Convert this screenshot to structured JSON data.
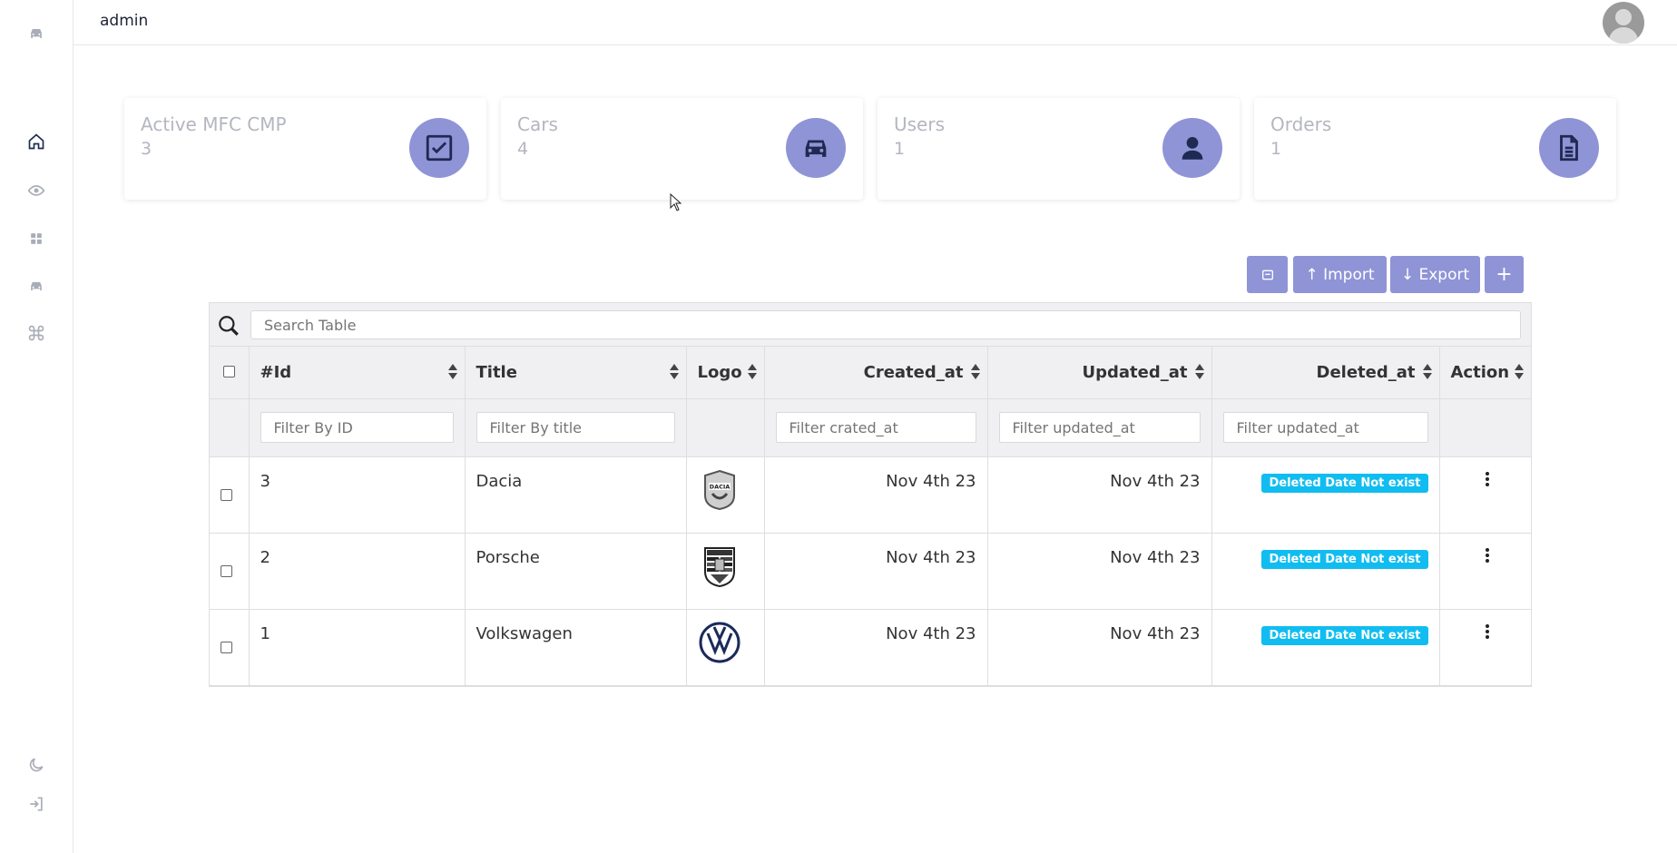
{
  "app": {
    "title": "admin"
  },
  "sidebar": {
    "items": [
      {
        "icon": "car-icon"
      },
      {
        "icon": "home-icon"
      },
      {
        "icon": "eye-icon"
      },
      {
        "icon": "grid-icon"
      },
      {
        "icon": "car-icon"
      },
      {
        "icon": "command-icon"
      },
      {
        "icon": "moon-icon"
      },
      {
        "icon": "logout-icon"
      }
    ]
  },
  "cards": [
    {
      "label": "Active MFC CMP",
      "value": "3",
      "icon": "checkbox-icon"
    },
    {
      "label": "Cars",
      "value": "4",
      "icon": "car-icon"
    },
    {
      "label": "Users",
      "value": "1",
      "icon": "user-icon"
    },
    {
      "label": "Orders",
      "value": "1",
      "icon": "document-icon"
    }
  ],
  "toolbar": {
    "import_label": "↑ Import",
    "export_label": "↓ Export",
    "add_label": "+"
  },
  "search": {
    "placeholder": "Search Table"
  },
  "table": {
    "columns": [
      "#Id",
      "Title",
      "Logo",
      "Created_at",
      "Updated_at",
      "Deleted_at",
      "Action"
    ],
    "filters": {
      "id": "Filter By ID",
      "title": "Filter By title",
      "created": "Filter crated_at",
      "updated": "Filter updated_at",
      "deleted": "Filter updated_at"
    },
    "rows": [
      {
        "id": "3",
        "title": "Dacia",
        "logo": "dacia-logo",
        "created": "Nov 4th 23",
        "updated": "Nov 4th 23",
        "deleted": "Deleted Date Not exist"
      },
      {
        "id": "2",
        "title": "Porsche",
        "logo": "porsche-logo",
        "created": "Nov 4th 23",
        "updated": "Nov 4th 23",
        "deleted": "Deleted Date Not exist"
      },
      {
        "id": "1",
        "title": "Volkswagen",
        "logo": "volkswagen-logo",
        "created": "Nov 4th 23",
        "updated": "Nov 4th 23",
        "deleted": "Deleted Date Not exist"
      }
    ]
  },
  "colors": {
    "accent": "#8f94d6",
    "badge": "#11bdf0",
    "icon_dark": "#1e2a52"
  }
}
